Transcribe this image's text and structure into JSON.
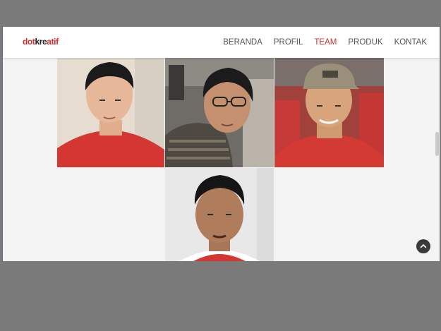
{
  "brand": {
    "logo_dot": "dot",
    "logo_kre": "kre",
    "logo_atif": "atif"
  },
  "nav": {
    "items": [
      {
        "label": "BERANDA",
        "active": false
      },
      {
        "label": "PROFIL",
        "active": false
      },
      {
        "label": "TEAM",
        "active": true
      },
      {
        "label": "PRODUK",
        "active": false
      },
      {
        "label": "KONTAK",
        "active": false
      }
    ]
  },
  "team": {
    "members": [
      {
        "photo": "team-member-photo-1"
      },
      {
        "photo": "team-member-photo-2"
      },
      {
        "photo": "team-member-photo-3"
      },
      {
        "photo": "team-member-photo-4"
      }
    ]
  },
  "colors": {
    "accent": "#c73232",
    "shirt_red": "#d23a33",
    "nav_text": "#555555",
    "page_bg": "#f3f3f3"
  },
  "icons": {
    "back_to_top": "chevron-up-icon"
  }
}
